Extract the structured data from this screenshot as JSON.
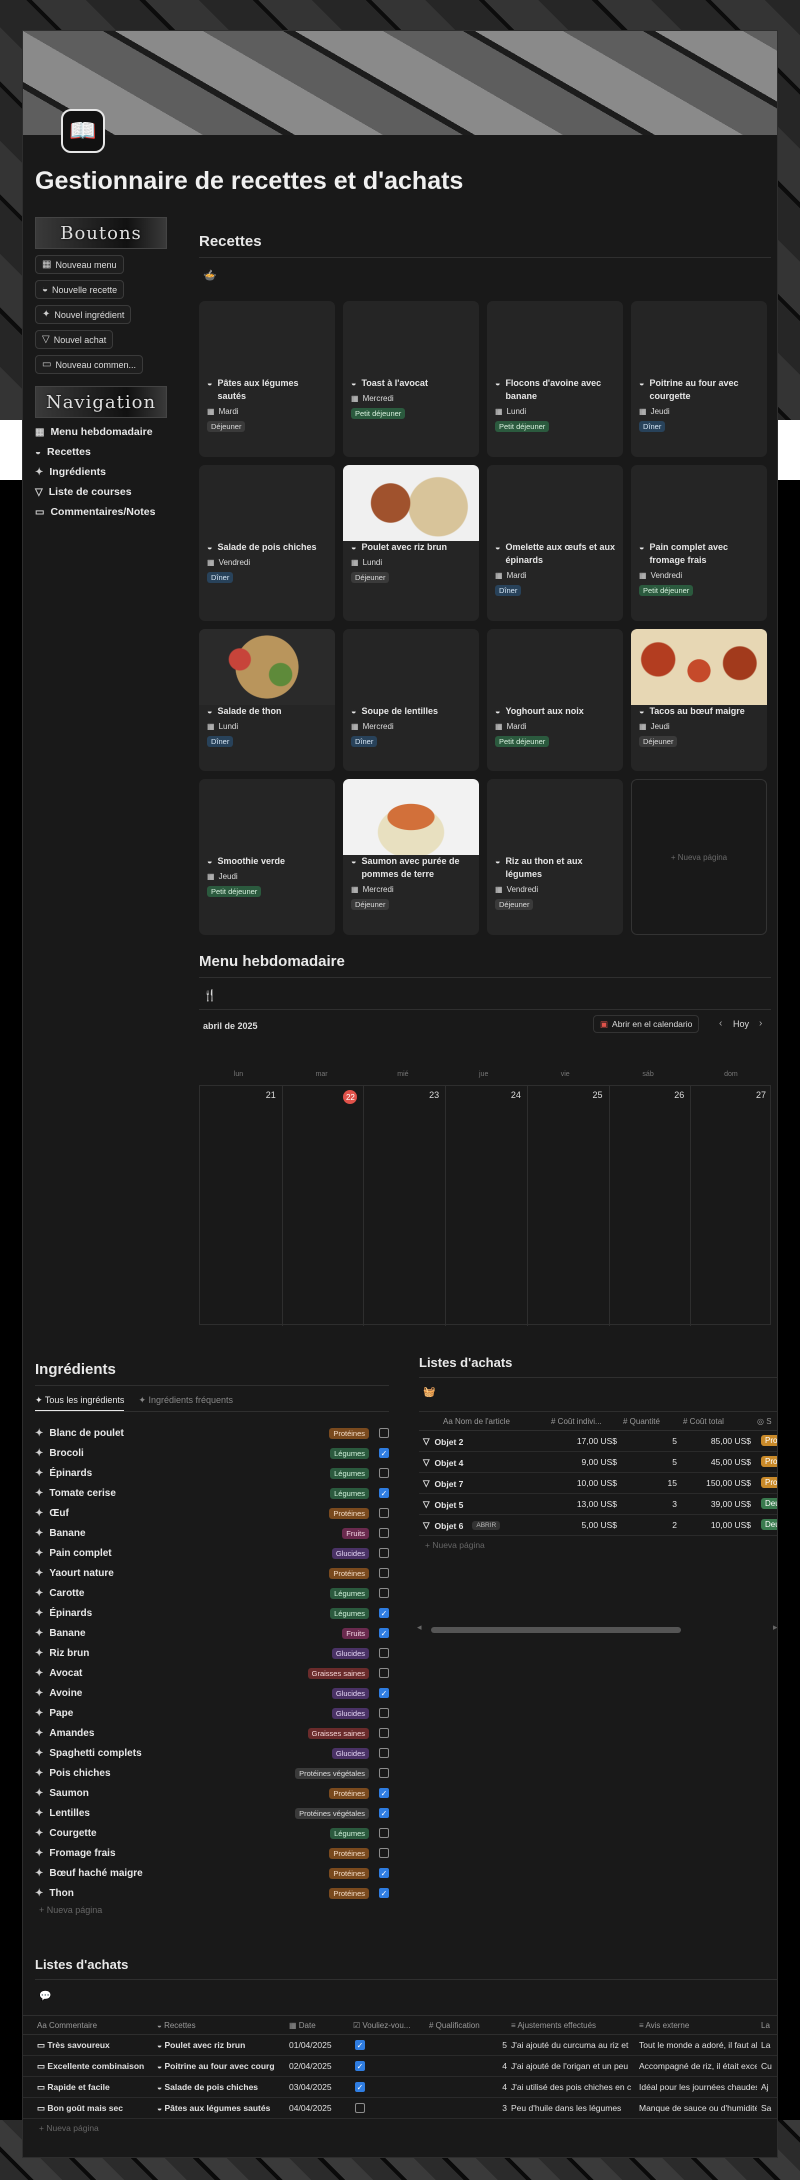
{
  "page": {
    "title": "Gestionnaire de recettes et d'achats"
  },
  "buttons_banner": "Boutons",
  "navigation_banner": "Navigation",
  "buttons": [
    {
      "label": "Nouveau menu",
      "icon": "calendar-icon"
    },
    {
      "label": "Nouvelle recette",
      "icon": "bowl-icon"
    },
    {
      "label": "Nouvel ingrédient",
      "icon": "carrot-icon"
    },
    {
      "label": "Nouvel achat",
      "icon": "basket-icon"
    },
    {
      "label": "Nouveau commen...",
      "icon": "comment-icon"
    }
  ],
  "navigation": [
    {
      "label": "Menu hebdomadaire",
      "icon": "calendar-icon"
    },
    {
      "label": "Recettes",
      "icon": "bowl-icon"
    },
    {
      "label": "Ingrédients",
      "icon": "carrot-icon"
    },
    {
      "label": "Liste de courses",
      "icon": "basket-icon"
    },
    {
      "label": "Commentaires/Notes",
      "icon": "comment-icon"
    }
  ],
  "recipes": {
    "heading": "Recettes",
    "new_page": "+ Nueva página",
    "cards": [
      {
        "title": "Pâtes aux légumes sautés",
        "day": "Mardi",
        "meal": "Déjeuner",
        "tag": "dej",
        "image": ""
      },
      {
        "title": "Toast à l'avocat",
        "day": "Mercredi",
        "meal": "Petit déjeuner",
        "tag": "pdej",
        "image": ""
      },
      {
        "title": "Flocons d'avoine avec banane",
        "day": "Lundi",
        "meal": "Petit déjeuner",
        "tag": "pdej",
        "image": ""
      },
      {
        "title": "Poitrine au four avec courgette",
        "day": "Jeudi",
        "meal": "Dîner",
        "tag": "din",
        "image": ""
      },
      {
        "title": "Salade de pois chiches",
        "day": "Vendredi",
        "meal": "Dîner",
        "tag": "din",
        "image": ""
      },
      {
        "title": "Poulet avec riz brun",
        "day": "Lundi",
        "meal": "Déjeuner",
        "tag": "dej",
        "image": "food1"
      },
      {
        "title": "Omelette aux œufs et aux épinards",
        "day": "Mardi",
        "meal": "Dîner",
        "tag": "din",
        "image": ""
      },
      {
        "title": "Pain complet avec fromage frais",
        "day": "Vendredi",
        "meal": "Petit déjeuner",
        "tag": "pdej",
        "image": ""
      },
      {
        "title": "Salade de thon",
        "day": "Lundi",
        "meal": "Dîner",
        "tag": "din",
        "image": "food2"
      },
      {
        "title": "Soupe de lentilles",
        "day": "Mercredi",
        "meal": "Dîner",
        "tag": "din",
        "image": ""
      },
      {
        "title": "Yoghourt aux noix",
        "day": "Mardi",
        "meal": "Petit déjeuner",
        "tag": "pdej",
        "image": ""
      },
      {
        "title": "Tacos au bœuf maigre",
        "day": "Jeudi",
        "meal": "Déjeuner",
        "tag": "dej",
        "image": "food3"
      },
      {
        "title": "Smoothie verde",
        "day": "Jeudi",
        "meal": "Petit déjeuner",
        "tag": "pdej",
        "image": ""
      },
      {
        "title": "Saumon avec purée de pommes de terre",
        "day": "Mercredi",
        "meal": "Déjeuner",
        "tag": "dej",
        "image": "food4"
      },
      {
        "title": "Riz au thon et aux légumes",
        "day": "Vendredi",
        "meal": "Déjeuner",
        "tag": "dej",
        "image": ""
      }
    ]
  },
  "menu": {
    "heading": "Menu hebdomadaire",
    "month": "abril de 2025",
    "open_calendar": "Abrir en el calendario",
    "today_btn": "Hoy",
    "weekdays": [
      "lun",
      "mar",
      "mié",
      "jue",
      "vie",
      "sáb",
      "dom"
    ],
    "days": [
      "21",
      "22",
      "23",
      "24",
      "25",
      "26",
      "27"
    ]
  },
  "ingredients": {
    "heading": "Ingrédients",
    "tabs": [
      "Tous les ingrédients",
      "Ingrédients fréquents"
    ],
    "new_page": "+ Nueva página",
    "rows": [
      {
        "name": "Blanc de poulet",
        "cat": "Protéines",
        "cls": "c-prot",
        "checked": false
      },
      {
        "name": "Brocoli",
        "cat": "Légumes",
        "cls": "c-leg",
        "checked": true
      },
      {
        "name": "Épinards",
        "cat": "Légumes",
        "cls": "c-leg",
        "checked": false
      },
      {
        "name": "Tomate cerise",
        "cat": "Légumes",
        "cls": "c-leg",
        "checked": true
      },
      {
        "name": "Œuf",
        "cat": "Protéines",
        "cls": "c-prot",
        "checked": false
      },
      {
        "name": "Banane",
        "cat": "Fruits",
        "cls": "c-fru",
        "checked": false
      },
      {
        "name": "Pain complet",
        "cat": "Glucides",
        "cls": "c-glu",
        "checked": false
      },
      {
        "name": "Yaourt nature",
        "cat": "Protéines",
        "cls": "c-prot",
        "checked": false
      },
      {
        "name": "Carotte",
        "cat": "Légumes",
        "cls": "c-leg",
        "checked": false
      },
      {
        "name": "Épinards",
        "cat": "Légumes",
        "cls": "c-leg",
        "checked": true
      },
      {
        "name": "Banane",
        "cat": "Fruits",
        "cls": "c-fru",
        "checked": true
      },
      {
        "name": "Riz brun",
        "cat": "Glucides",
        "cls": "c-glu",
        "checked": false
      },
      {
        "name": "Avocat",
        "cat": "Graisses saines",
        "cls": "c-grs",
        "checked": false
      },
      {
        "name": "Avoine",
        "cat": "Glucides",
        "cls": "c-glu",
        "checked": true
      },
      {
        "name": "Pape",
        "cat": "Glucides",
        "cls": "c-glu",
        "checked": false
      },
      {
        "name": "Amandes",
        "cat": "Graisses saines",
        "cls": "c-grs",
        "checked": false
      },
      {
        "name": "Spaghetti complets",
        "cat": "Glucides",
        "cls": "c-glu",
        "checked": false
      },
      {
        "name": "Pois chiches",
        "cat": "Protéines végétales",
        "cls": "c-pv",
        "checked": false
      },
      {
        "name": "Saumon",
        "cat": "Protéines",
        "cls": "c-prot",
        "checked": true
      },
      {
        "name": "Lentilles",
        "cat": "Protéines végétales",
        "cls": "c-pv",
        "checked": true
      },
      {
        "name": "Courgette",
        "cat": "Légumes",
        "cls": "c-leg",
        "checked": false
      },
      {
        "name": "Fromage frais",
        "cat": "Protéines",
        "cls": "c-prot",
        "checked": false
      },
      {
        "name": "Bœuf haché maigre",
        "cat": "Protéines",
        "cls": "c-prot",
        "checked": true
      },
      {
        "name": "Thon",
        "cat": "Protéines",
        "cls": "c-prot",
        "checked": true
      }
    ]
  },
  "shopping": {
    "heading": "Listes d'achats",
    "headers": [
      "Nom de l'article",
      "Coût indivi...",
      "Quantité",
      "Coût total",
      "S"
    ],
    "open_label": "ABRIR",
    "new_page": "+ Nueva página",
    "rows": [
      {
        "name": "Objet 2",
        "unit": "17,00 US$",
        "qty": "5",
        "total": "85,00 US$",
        "status": "Pro",
        "color": "#c98a2a"
      },
      {
        "name": "Objet 4",
        "unit": "9,00 US$",
        "qty": "5",
        "total": "45,00 US$",
        "status": "Pro",
        "color": "#c98a2a"
      },
      {
        "name": "Objet 7",
        "unit": "10,00 US$",
        "qty": "15",
        "total": "150,00 US$",
        "status": "Pro",
        "color": "#c98a2a"
      },
      {
        "name": "Objet 5",
        "unit": "13,00 US$",
        "qty": "3",
        "total": "39,00 US$",
        "status": "Deu",
        "color": "#3a7a4e"
      },
      {
        "name": "Objet 6",
        "unit": "5,00 US$",
        "qty": "2",
        "total": "10,00 US$",
        "status": "Deu",
        "color": "#3a7a4e"
      }
    ]
  },
  "comments": {
    "heading": "Listes d'achats",
    "headers": [
      "Commentaire",
      "Recettes",
      "Date",
      "Vouliez-vou...",
      "Qualification",
      "Ajustements effectués",
      "Avis externe",
      "La"
    ],
    "new_page": "+ Nueva página",
    "rows": [
      {
        "comment": "Très savoureux",
        "recipe": "Poulet avec riz brun",
        "date": "01/04/2025",
        "checked": true,
        "rating": "5",
        "adjust": "J'ai ajouté du curcuma au riz et",
        "avis": "Tout le monde a adoré, il faut ab",
        "la": "La"
      },
      {
        "comment": "Excellente combinaison",
        "recipe": "Poitrine au four avec courg",
        "date": "02/04/2025",
        "checked": true,
        "rating": "4",
        "adjust": "J'ai ajouté de l'origan et un peu",
        "avis": "Accompagné de riz, il était exce",
        "la": "Cu"
      },
      {
        "comment": "Rapide et facile",
        "recipe": "Salade de pois chiches",
        "date": "03/04/2025",
        "checked": true,
        "rating": "4",
        "adjust": "J'ai utilisé des pois chiches en c",
        "avis": "Idéal pour les journées chaudes",
        "la": "Aj"
      },
      {
        "comment": "Bon goût mais sec",
        "recipe": "Pâtes aux légumes sautés",
        "date": "04/04/2025",
        "checked": false,
        "rating": "3",
        "adjust": "Peu d'huile dans les légumes",
        "avis": "Manque de sauce ou d'humidité",
        "la": "Sa"
      }
    ]
  }
}
